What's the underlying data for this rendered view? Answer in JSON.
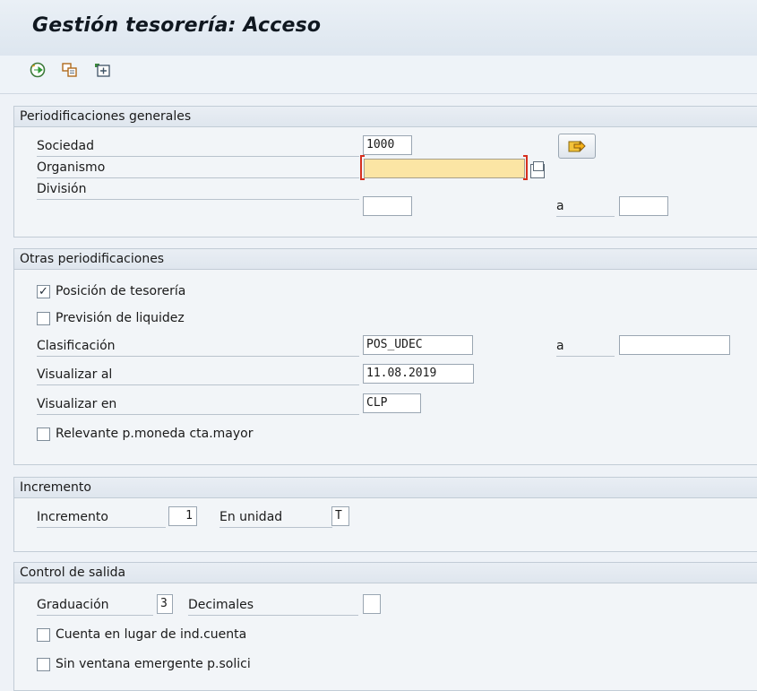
{
  "window": {
    "title": "Gestión tesorería: Acceso"
  },
  "toolbar": {
    "icons": [
      "execute-icon",
      "copy-variant-icon",
      "selection-options-icon"
    ]
  },
  "sections": {
    "general": {
      "header": "Periodificaciones generales",
      "sociedad": {
        "label": "Sociedad",
        "value": "1000"
      },
      "organismo": {
        "label": "Organismo",
        "value": ""
      },
      "division": {
        "label": "División",
        "value": "",
        "to_label": "a",
        "to_value": ""
      }
    },
    "otras": {
      "header": "Otras periodificaciones",
      "posicion": {
        "label": "Posición de tesorería",
        "checked": true,
        "mark": "✓"
      },
      "prevision": {
        "label": "Previsión de liquidez",
        "checked": false
      },
      "clasificacion": {
        "label": "Clasificación",
        "value": "POS_UDEC",
        "to_label": "a",
        "to_value": ""
      },
      "visualizar_al": {
        "label": "Visualizar al",
        "value": "11.08.2019"
      },
      "visualizar_en": {
        "label": "Visualizar en",
        "value": "CLP"
      },
      "relevante": {
        "label": "Relevante p.moneda cta.mayor",
        "checked": false
      }
    },
    "incremento": {
      "header": "Incremento",
      "incremento": {
        "label": "Incremento",
        "value": "1"
      },
      "unidad": {
        "label": "En unidad",
        "value": "T"
      }
    },
    "control": {
      "header": "Control de salida",
      "graduacion": {
        "label": "Graduación",
        "value": "3"
      },
      "decimales": {
        "label": "Decimales",
        "value": ""
      },
      "cuenta": {
        "label": "Cuenta en lugar de ind.cuenta",
        "checked": false
      },
      "sin_ventana": {
        "label": "Sin ventana emergente p.solici",
        "checked": false
      }
    }
  },
  "colors": {
    "required_field": "#fbe5a4",
    "required_marker": "#d6301f",
    "panel_bg": "#f2f5f8",
    "page_bg": "#eef2f7"
  }
}
